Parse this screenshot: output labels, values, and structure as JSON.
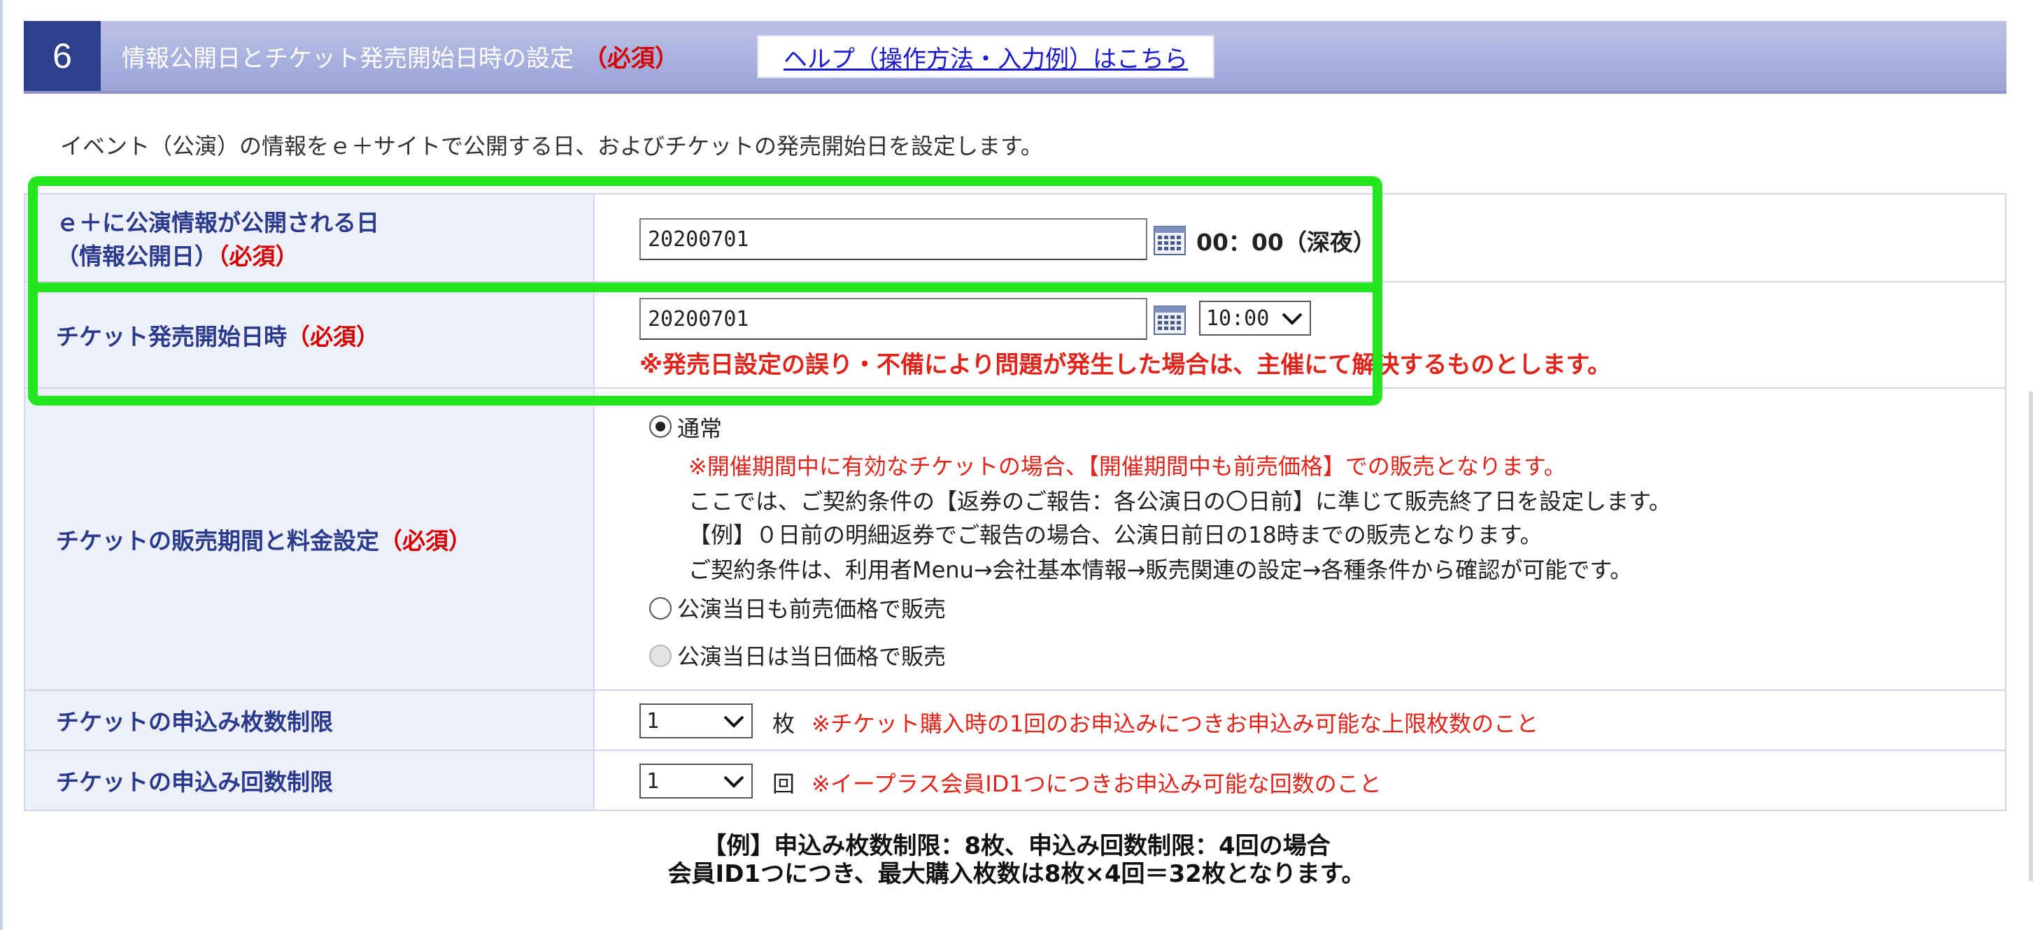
{
  "header": {
    "number": "6",
    "title": "情報公開日とチケット発売開始日時の設定",
    "required": "（必須）",
    "help_link": "ヘルプ（操作方法・入力例）はこちら"
  },
  "intro": "イベント（公演）の情報をｅ＋サイトで公開する日、およびチケットの発売開始日を設定します。",
  "rows": {
    "publish": {
      "label_line1": "ｅ＋に公演情報が公開される日",
      "label_line2": "（情報公開日）",
      "required": "（必須）",
      "date_value": "20200701",
      "time_text": "00：00（深夜）"
    },
    "sale_start": {
      "label": "チケット発売開始日時",
      "required": "（必須）",
      "date_value": "20200701",
      "time_selected": "10:00",
      "warning": "※発売日設定の誤り・不備により問題が発生した場合は、主催にて解決するものとします。"
    },
    "sale_period": {
      "label": "チケットの販売期間と料金設定",
      "required": "（必須）",
      "option_normal": "通常",
      "note_red": "※開催期間中に有効なチケットの場合、【開催期間中も前売価格】での販売となります。",
      "note1": "ここでは、ご契約条件の【返券のご報告：各公演日の〇日前】に準じて販売終了日を設定します。",
      "note2": "【例】０日前の明細返券でご報告の場合、公演日前日の18時までの販売となります。",
      "note3": "ご契約条件は、利用者Menu→会社基本情報→販売関連の設定→各種条件から確認が可能です。",
      "option_advance": "公演当日も前売価格で販売",
      "option_dayof": "公演当日は当日価格で販売"
    },
    "qty_limit": {
      "label": "チケットの申込み枚数制限",
      "selected": "1",
      "unit": "枚",
      "note": "※チケット購入時の1回のお申込みにつきお申込み可能な上限枚数のこと"
    },
    "count_limit": {
      "label": "チケットの申込み回数制限",
      "selected": "1",
      "unit": "回",
      "note": "※イープラス会員ID1つにつきお申込み可能な回数のこと"
    }
  },
  "example": {
    "line1": "【例】申込み枚数制限：8枚、申込み回数制限：4回の場合",
    "line2": "会員ID1つにつき、最大購入枚数は8枚×4回＝32枚となります。"
  },
  "colors": {
    "header_blue": "#2e3f8e",
    "label_text": "#2a3a8c",
    "required_red": "#d40000",
    "note_red": "#e0241a",
    "highlight_green": "#22e61e"
  }
}
